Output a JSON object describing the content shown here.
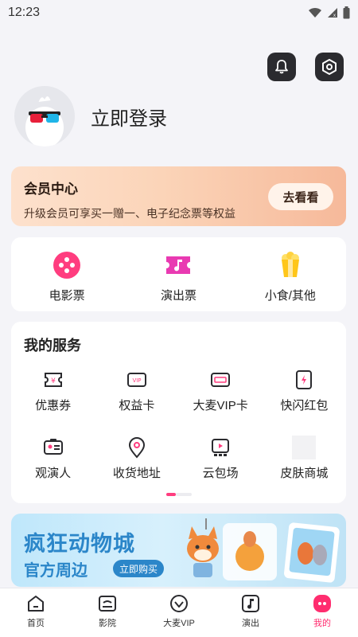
{
  "status_bar": {
    "time": "12:23"
  },
  "profile": {
    "login_text": "立即登录"
  },
  "member_center": {
    "title": "会员中心",
    "subtitle": "升级会员可享买一赠一、电子纪念票等权益",
    "button_label": "去看看"
  },
  "tickets": [
    {
      "label": "电影票",
      "icon": "movie-reel-icon"
    },
    {
      "label": "演出票",
      "icon": "music-ticket-icon"
    },
    {
      "label": "小食/其他",
      "icon": "popcorn-icon"
    }
  ],
  "services": {
    "title": "我的服务",
    "items": [
      {
        "label": "优惠券",
        "icon": "coupon-icon"
      },
      {
        "label": "权益卡",
        "icon": "vip-card-icon"
      },
      {
        "label": "大麦VIP卡",
        "icon": "damai-card-icon"
      },
      {
        "label": "快闪红包",
        "icon": "flash-redpacket-icon"
      },
      {
        "label": "观演人",
        "icon": "id-card-icon"
      },
      {
        "label": "收货地址",
        "icon": "location-pin-icon"
      },
      {
        "label": "云包场",
        "icon": "cloud-screening-icon"
      },
      {
        "label": "皮肤商城",
        "icon": "skin-shop-icon"
      }
    ]
  },
  "banner": {
    "main_text": "疯狂动物城",
    "sub_text": "官方周边",
    "button_label": "立即购买"
  },
  "tabbar": [
    {
      "label": "首页",
      "icon": "home-icon",
      "active": false
    },
    {
      "label": "影院",
      "icon": "cinema-icon",
      "active": false
    },
    {
      "label": "大麦VIP",
      "icon": "vip-heart-icon",
      "active": false
    },
    {
      "label": "演出",
      "icon": "music-note-icon",
      "active": false
    },
    {
      "label": "我的",
      "icon": "profile-icon",
      "active": true
    }
  ],
  "colors": {
    "accent": "#ff2d6f",
    "banner_blue": "#2b86c9",
    "member_bg": "#fbd4b8"
  }
}
